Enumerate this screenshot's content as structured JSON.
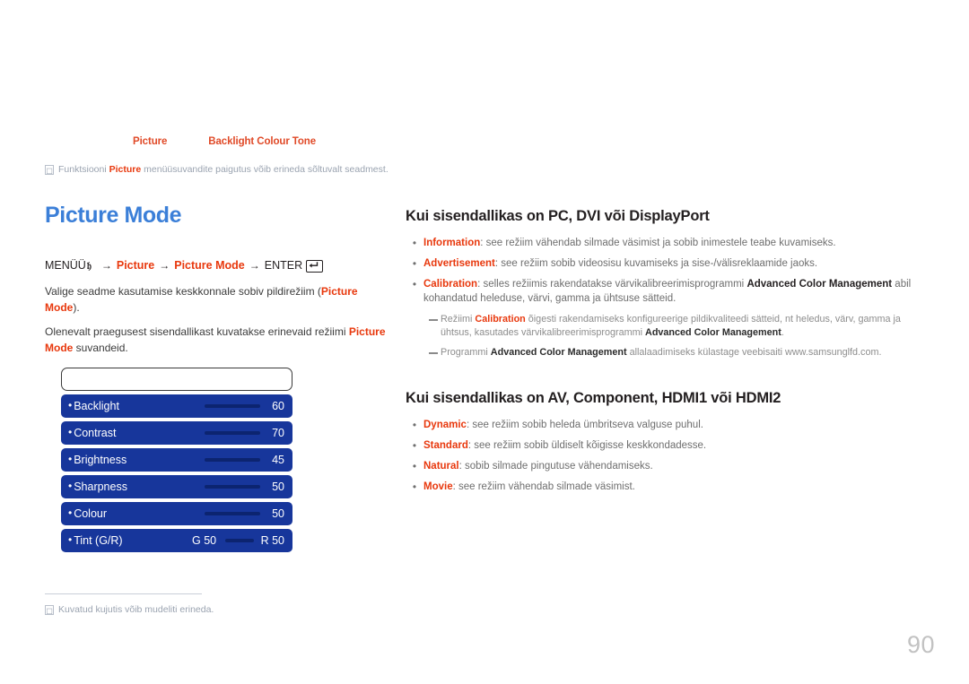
{
  "breadcrumb": {
    "items": [
      "Picture",
      "Backlight  Colour Tone"
    ]
  },
  "top_note": {
    "mark": "✉",
    "text_before": "Funktsiooni ",
    "text_bold": "Picture",
    "text_after": " menüüsuvandite paigutus võib erineda sõltuvalt seadmest."
  },
  "left": {
    "title": "Picture Mode",
    "menu_path": {
      "menu_label": "MENÜÜ",
      "menu_icon": "menu-m-icon",
      "arrow": "→",
      "step1": "Picture",
      "step2": "Picture Mode",
      "enter_label": "ENTER",
      "enter_icon": "enter-key-icon"
    },
    "paragraph1_a": "Valige seadme kasutamise keskkonnale sobiv pildirežiim (",
    "paragraph1_red": "Picture Mode",
    "paragraph1_b": ").",
    "paragraph2_a": "Olenevalt praegusest sisendallikast kuvatakse erinevaid režiimi ",
    "paragraph2_red": "Picture Mode",
    "paragraph2_b": " suvandeid."
  },
  "osd": {
    "title": "",
    "items": [
      {
        "label": "Backlight",
        "value": "60",
        "type": "slider"
      },
      {
        "label": "Contrast",
        "value": "70",
        "type": "slider"
      },
      {
        "label": "Brightness",
        "value": "45",
        "type": "slider"
      },
      {
        "label": "Sharpness",
        "value": "50",
        "type": "slider"
      },
      {
        "label": "Colour",
        "value": "50",
        "type": "slider"
      },
      {
        "label": "Tint (G/R)",
        "value": "R 50",
        "green_value": "G 50",
        "type": "tint"
      }
    ]
  },
  "footnote": {
    "mark": "✉",
    "text": "Kuvatud kujutis võib mudeliti erineda."
  },
  "right": {
    "section1": {
      "title": "Kui sisendallikas on PC, DVI või DisplayPort",
      "bullets": [
        {
          "term": "Information",
          "rest": ": see režiim vähendab silmade väsimist ja sobib inimestele teabe kuvamiseks."
        },
        {
          "term": "Advertisement",
          "rest": ": see režiim sobib videosisu kuvamiseks ja sise-/välisreklaamide jaoks."
        },
        {
          "term": "Calibration",
          "rest": ": selles režiimis rakendatakse värvikalibreerimisprogrammi ",
          "strong": "Advanced Color Management",
          "rest2": " abil kohandatud heleduse, värvi, gamma ja ühtsuse sätteid."
        }
      ],
      "subnotes": [
        {
          "a": "Režiimi ",
          "term": "Calibration",
          "b": " õigesti rakendamiseks konfigureerige pildikvaliteedi sätteid, nt heledus, värv, gamma ja ühtsus, kasutades värvikalibreerimisprogrammi ",
          "strong": "Advanced Color Management",
          "c": "."
        },
        {
          "a": "Programmi ",
          "strong": "Advanced Color Management",
          "b": " allalaadimiseks külastage veebisaiti www.samsunglfd.com.",
          "c": ""
        }
      ]
    },
    "section2": {
      "title": "Kui sisendallikas on AV, Component, HDMI1 või HDMI2",
      "bullets": [
        {
          "term": "Dynamic",
          "rest": ": see režiim sobib heleda ümbritseva valguse puhul."
        },
        {
          "term": "Standard",
          "rest": ": see režiim sobib üldiselt kõigisse keskkondadesse."
        },
        {
          "term": "Natural",
          "rest": ": sobib silmade pingutuse vähendamiseks."
        },
        {
          "term": "Movie",
          "rest": ": see režiim vähendab silmade väsimist."
        }
      ]
    }
  },
  "page_number": "90",
  "colors": {
    "accent_red": "#e8380d",
    "title_blue": "#3b7fd8",
    "osd_blue": "#17369b",
    "osd_bar": "#0c2470",
    "muted": "#9aa3b0"
  }
}
